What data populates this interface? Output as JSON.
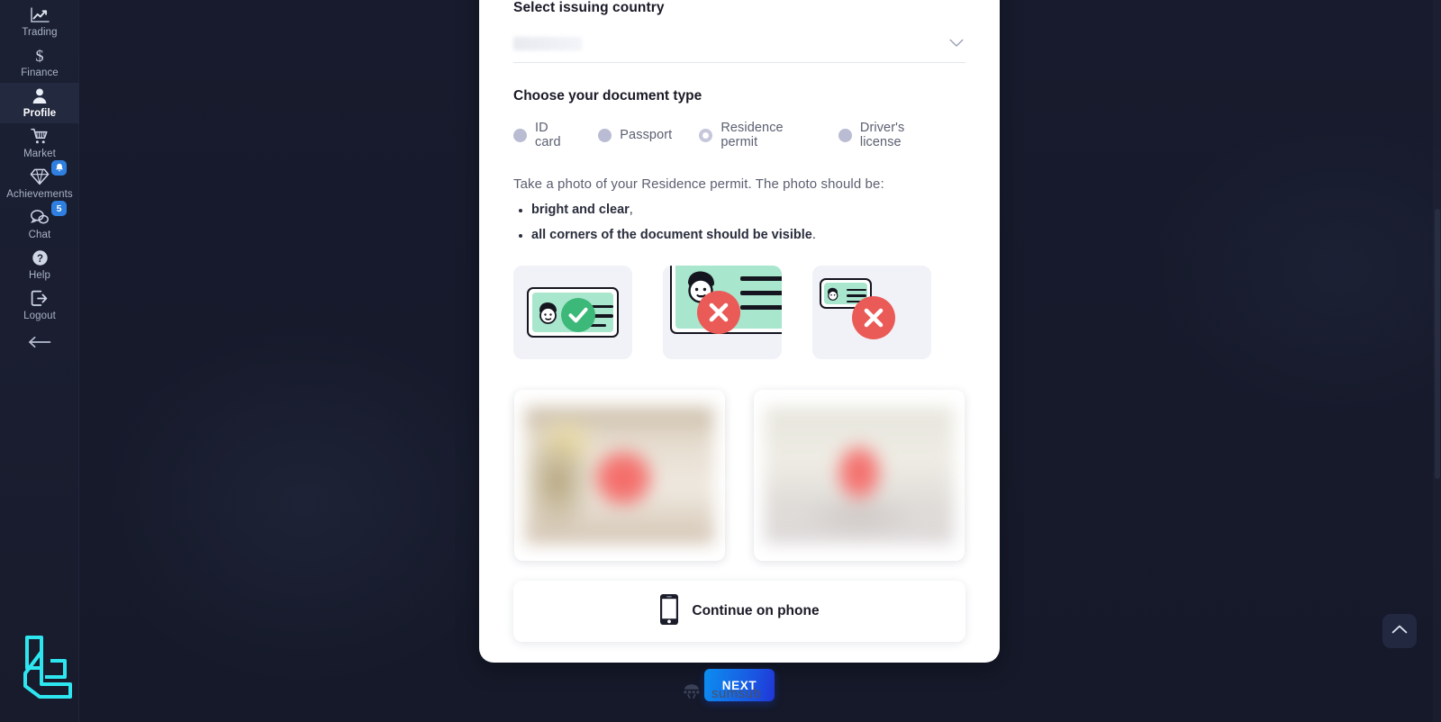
{
  "sidebar": {
    "items": [
      {
        "label": "Trading",
        "icon": "chart-line-icon",
        "active": false,
        "badge": null
      },
      {
        "label": "Finance",
        "icon": "dollar-icon",
        "active": false,
        "badge": null
      },
      {
        "label": "Profile",
        "icon": "user-icon",
        "active": true,
        "badge": null
      },
      {
        "label": "Market",
        "icon": "cart-icon",
        "active": false,
        "badge": null
      },
      {
        "label": "Achievements",
        "icon": "diamond-icon",
        "active": false,
        "badge": "bell"
      },
      {
        "label": "Chat",
        "icon": "chat-bubble-icon",
        "active": false,
        "badge": "5"
      },
      {
        "label": "Help",
        "icon": "question-circle-icon",
        "active": false,
        "badge": null
      },
      {
        "label": "Logout",
        "icon": "logout-icon",
        "active": false,
        "badge": null
      }
    ],
    "collapse_icon": "arrow-left-icon",
    "logo": "brand-monogram-logo",
    "accent_color": "#2ee6f0",
    "badge_color": "#2f7fe0"
  },
  "verification": {
    "country_label": "Select issuing country",
    "country_value": "",
    "country_placeholder": "",
    "doc_type_label": "Choose your document type",
    "doc_types": [
      {
        "label": "ID card",
        "selected": false
      },
      {
        "label": "Passport",
        "selected": false
      },
      {
        "label": "Residence permit",
        "selected": true
      },
      {
        "label": "Driver's license",
        "selected": false
      }
    ],
    "instruction": "Take a photo of your Residence permit. The photo should be:",
    "requirements": [
      {
        "bold": "bright and clear",
        "tail": ","
      },
      {
        "bold": "all corners of the document should be visible",
        "tail": "."
      }
    ],
    "samples": [
      {
        "name": "good-example",
        "status": "ok"
      },
      {
        "name": "too-close-example",
        "status": "no"
      },
      {
        "name": "too-far-example",
        "status": "no"
      }
    ],
    "previews": [
      {
        "name": "front-side-preview"
      },
      {
        "name": "back-side-preview"
      }
    ],
    "continue_on_phone_label": "Continue on phone",
    "continue_on_phone_icon": "smartphone-icon",
    "next_label": "NEXT",
    "next_gradient_from": "#0c8ef0",
    "next_gradient_to": "#2035d6"
  },
  "footer": {
    "brand": "sumsub",
    "icon": "sumsub-logo-icon"
  },
  "controls": {
    "scroll_top_icon": "chevron-up-icon"
  }
}
